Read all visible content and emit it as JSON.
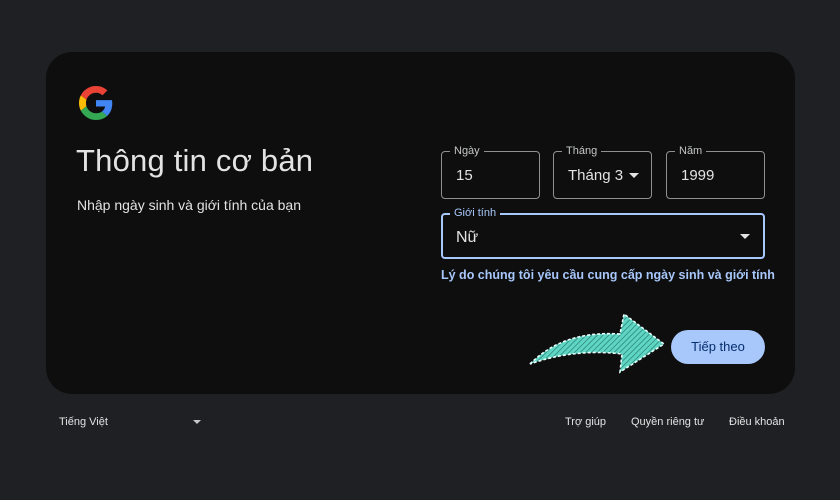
{
  "page": {
    "title": "Thông tin cơ bản",
    "subtitle": "Nhập ngày sinh và giới tính của bạn"
  },
  "form": {
    "day": {
      "label": "Ngày",
      "value": "15"
    },
    "month": {
      "label": "Tháng",
      "value": "Tháng 3"
    },
    "year": {
      "label": "Năm",
      "value": "1999"
    },
    "gender": {
      "label": "Giới tính",
      "value": "Nữ"
    },
    "why_link": "Lý do chúng tôi yêu cầu cung cấp ngày sinh và giới tính",
    "next_label": "Tiếp theo"
  },
  "footer": {
    "language": "Tiếng Việt",
    "help": "Trợ giúp",
    "privacy": "Quyền riêng tư",
    "terms": "Điều khoản"
  },
  "colors": {
    "page_bg": "#1f2023",
    "card_bg": "#0e0e0f",
    "accent": "#a8c7fa",
    "annotation_arrow": "#5fd6c4"
  },
  "icons": {
    "logo": "google-logo-icon",
    "dropdown": "caret-down-icon",
    "annotation": "curved-arrow-icon"
  }
}
